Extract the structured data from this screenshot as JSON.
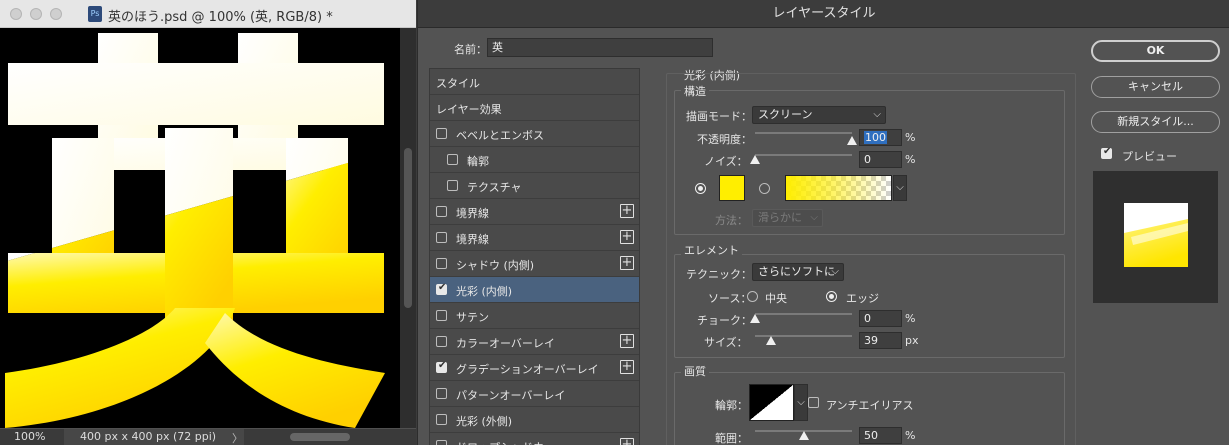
{
  "document": {
    "title": "英のほう.psd @ 100% (英, RGB/8) *",
    "ps_icon": "Ps",
    "glyph": "英",
    "zoom": "100%",
    "doc_size": "400 px x 400 px (72 ppi)",
    "status_arrow": "〉"
  },
  "dialog": {
    "title": "レイヤースタイル",
    "name_label": "名前：",
    "name_value": "英",
    "style_list": [
      {
        "label": "スタイル",
        "checkbox": false,
        "checked": false,
        "plus": false
      },
      {
        "label": "レイヤー効果",
        "checkbox": false,
        "checked": false,
        "plus": false
      },
      {
        "label": "ベベルとエンボス",
        "checkbox": true,
        "checked": false,
        "plus": false
      },
      {
        "label": "輪郭",
        "checkbox": true,
        "checked": false,
        "plus": false,
        "indent": true
      },
      {
        "label": "テクスチャ",
        "checkbox": true,
        "checked": false,
        "plus": false,
        "indent": true
      },
      {
        "label": "境界線",
        "checkbox": true,
        "checked": false,
        "plus": true
      },
      {
        "label": "境界線",
        "checkbox": true,
        "checked": false,
        "plus": true
      },
      {
        "label": "シャドウ (内側)",
        "checkbox": true,
        "checked": false,
        "plus": true
      },
      {
        "label": "光彩 (内側)",
        "checkbox": true,
        "checked": true,
        "plus": false,
        "selected": true
      },
      {
        "label": "サテン",
        "checkbox": true,
        "checked": false,
        "plus": false
      },
      {
        "label": "カラーオーバーレイ",
        "checkbox": true,
        "checked": false,
        "plus": true
      },
      {
        "label": "グラデーションオーバーレイ",
        "checkbox": true,
        "checked": true,
        "plus": true
      },
      {
        "label": "パターンオーバーレイ",
        "checkbox": true,
        "checked": false,
        "plus": false
      },
      {
        "label": "光彩 (外側)",
        "checkbox": true,
        "checked": false,
        "plus": false
      },
      {
        "label": "ドロップシャドウ",
        "checkbox": true,
        "checked": false,
        "plus": true
      }
    ],
    "section_title": "光彩 (内側)",
    "structure": {
      "title": "構造",
      "blend_mode_label": "描画モード：",
      "blend_mode_value": "スクリーン",
      "opacity_label": "不透明度：",
      "opacity_value": "100",
      "opacity_pct": 1.0,
      "noise_label": "ノイズ：",
      "noise_value": "0",
      "noise_pct": 0.0,
      "unit_percent": "%",
      "glow_color": "#ffee00",
      "method_label": "方法：",
      "method_value": "滑らかに"
    },
    "elements": {
      "title": "エレメント",
      "technique_label": "テクニック：",
      "technique_value": "さらにソフトに",
      "source_label": "ソース：",
      "source_center": "中央",
      "source_edge": "エッジ",
      "choke_label": "チョーク：",
      "choke_value": "0",
      "choke_pct": 0.0,
      "size_label": "サイズ：",
      "size_value": "39",
      "size_unit": "px",
      "size_pct": 0.16
    },
    "quality": {
      "title": "画質",
      "contour_label": "輪郭：",
      "antialias_label": "アンチエイリアス",
      "range_label": "範囲：",
      "range_value": "50",
      "range_pct": 0.5
    },
    "buttons": {
      "ok": "OK",
      "cancel": "キャンセル",
      "new_style": "新規スタイル..."
    },
    "preview_label": "プレビュー"
  }
}
